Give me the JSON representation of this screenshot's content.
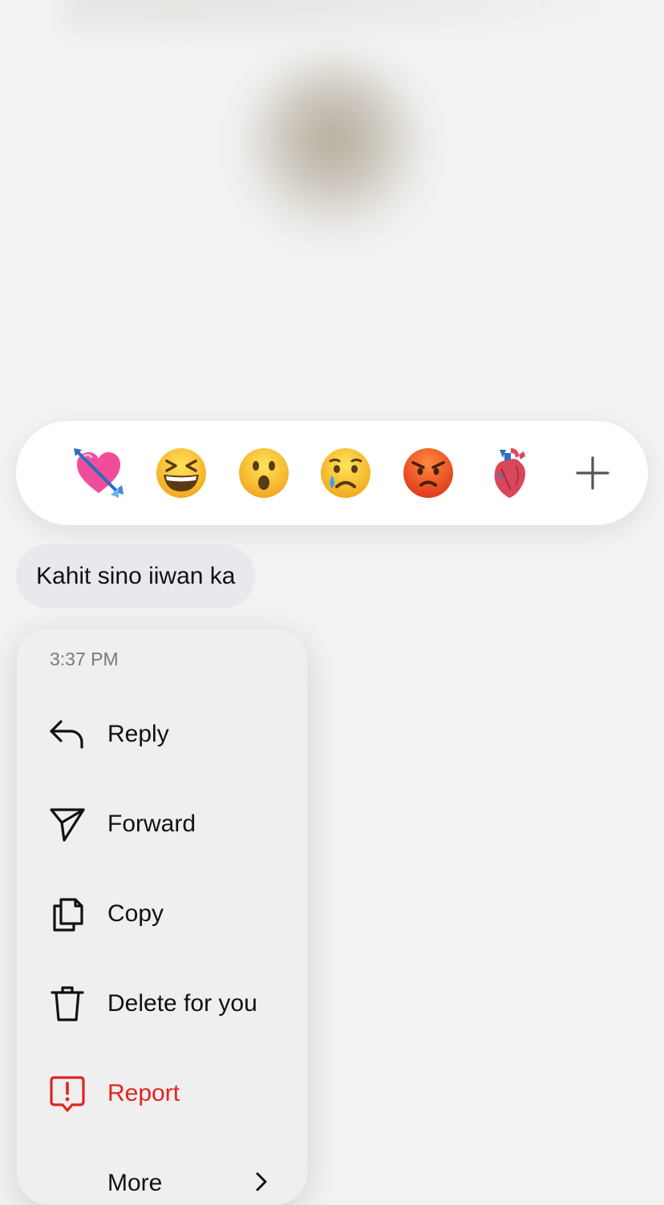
{
  "reactions": [
    {
      "name": "heart-with-arrow",
      "glyph": "💘"
    },
    {
      "name": "grinning-squinting",
      "glyph": "😆"
    },
    {
      "name": "surprised",
      "glyph": "😮"
    },
    {
      "name": "crying",
      "glyph": "😢"
    },
    {
      "name": "angry",
      "glyph": "😡"
    },
    {
      "name": "anatomical-heart",
      "glyph": "🫀"
    }
  ],
  "add_reaction_icon": "plus-icon",
  "message": {
    "text": "Kahit sino iiwan ka"
  },
  "menu": {
    "timestamp": "3:37 PM",
    "items": [
      {
        "label": "Reply",
        "icon": "reply-icon"
      },
      {
        "label": "Forward",
        "icon": "forward-icon"
      },
      {
        "label": "Copy",
        "icon": "copy-icon"
      },
      {
        "label": "Delete for you",
        "icon": "trash-icon"
      },
      {
        "label": "Report",
        "icon": "report-icon",
        "color": "#e0241f"
      },
      {
        "label": "More",
        "icon": "more-icon"
      }
    ]
  },
  "colors": {
    "danger": "#e0241f",
    "bubble": "#e9e9ed",
    "menu": "#efefef"
  }
}
